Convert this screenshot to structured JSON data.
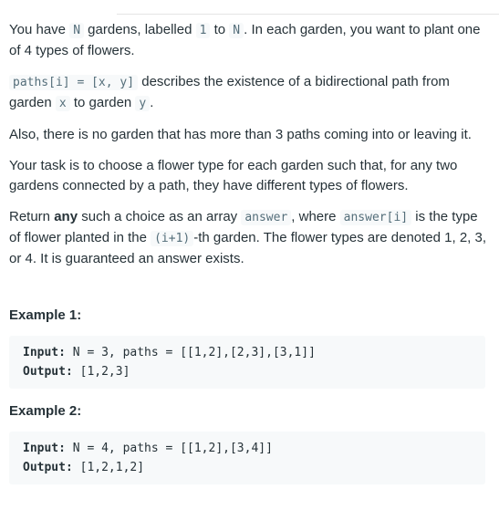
{
  "problem": {
    "p1": {
      "t1": "You have ",
      "c1": "N",
      "t2": " gardens, labelled ",
      "c2": "1",
      "t3": " to ",
      "c3": "N",
      "t4": ". In each garden, you want to plant one of 4 types of flowers."
    },
    "p2": {
      "c1": "paths[i] = [x, y]",
      "t1": " describes the existence of a bidirectional path from garden ",
      "c2": "x",
      "t2": " to garden ",
      "c3": "y",
      "t3": "."
    },
    "p3": "Also, there is no garden that has more than 3 paths coming into or leaving it.",
    "p4": "Your task is to choose a flower type for each garden such that, for any two gardens connected by a path, they have different types of flowers.",
    "p5": {
      "t1": "Return ",
      "b1": "any",
      "t2": " such a choice as an array ",
      "c1": "answer",
      "t3": ", where ",
      "c2": "answer[i]",
      "t4": " is the type of flower planted in the ",
      "c3": "(i+1)",
      "t5": "-th garden.  The flower types are denoted 1, 2, 3, or 4.  It is guaranteed an answer exists."
    }
  },
  "examples": [
    {
      "title": "Example 1:",
      "input_label": "Input:",
      "input_value": " N = 3, paths = [[1,2],[2,3],[3,1]]",
      "output_label": "Output:",
      "output_value": " [1,2,3]"
    },
    {
      "title": "Example 2:",
      "input_label": "Input:",
      "input_value": " N = 4, paths = [[1,2],[3,4]]",
      "output_label": "Output:",
      "output_value": " [1,2,1,2]"
    }
  ]
}
